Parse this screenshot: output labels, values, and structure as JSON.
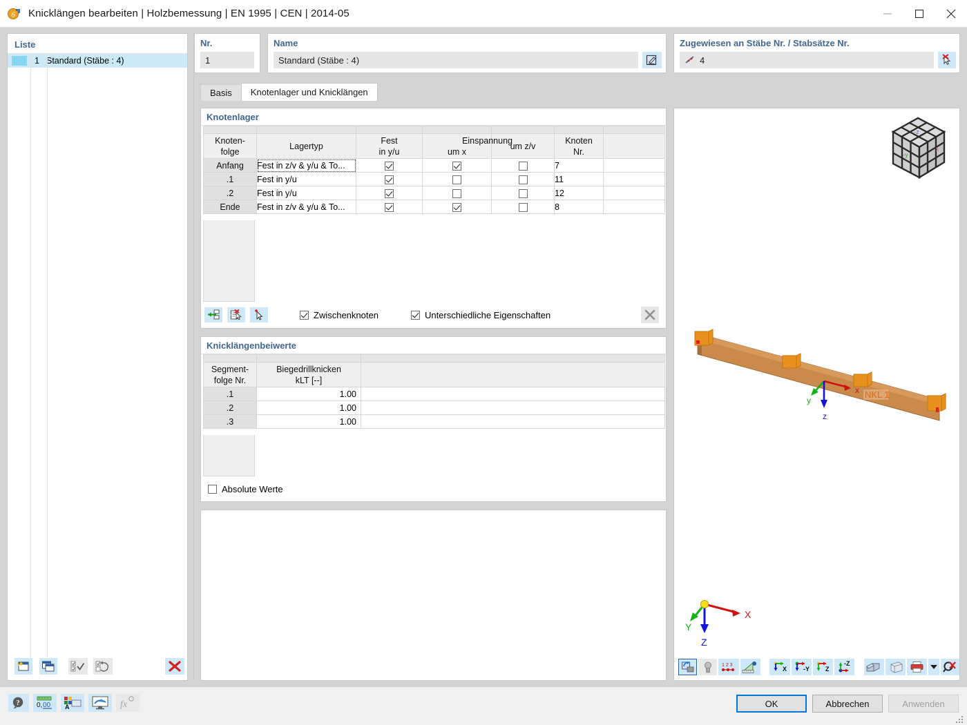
{
  "window": {
    "title": "Knicklängen bearbeiten | Holzbemessung | EN 1995 | CEN | 2014-05",
    "app_icon": "rfem-dimension-icon",
    "minimize_label": "—",
    "maximize_label": "□",
    "close_label": "✕"
  },
  "liste": {
    "title": "Liste",
    "rows": [
      {
        "number": "1",
        "label": "Standard (Stäbe : 4)",
        "color": "#86d6f2"
      }
    ],
    "toolbar": [
      {
        "name": "new-item-button",
        "tip": "Neu"
      },
      {
        "name": "copy-item-button",
        "tip": "Kopieren"
      },
      {
        "name": "select-all-button",
        "tip": "Alle auswählen"
      },
      {
        "name": "invert-selection-button",
        "tip": "Auswahl umkehren"
      },
      {
        "name": "delete-item-button",
        "tip": "Löschen"
      }
    ]
  },
  "nr": {
    "title": "Nr.",
    "value": "1"
  },
  "name": {
    "title": "Name",
    "value": "Standard (Stäbe : 4)",
    "edit_button": "edit-name-button"
  },
  "assigned": {
    "title": "Zugewiesen an Stäbe Nr. / Stabsätze Nr.",
    "value": "4",
    "pick_button": "pick-members-button"
  },
  "tabs": [
    {
      "label": "Basis",
      "active": false
    },
    {
      "label": "Knotenlager und Knicklängen",
      "active": true
    }
  ],
  "knotenlager": {
    "title": "Knotenlager",
    "columns": [
      {
        "l1": "Knoten-",
        "l2": "folge"
      },
      {
        "l1": "",
        "l2": "Lagertyp"
      },
      {
        "l1": "Fest",
        "l2": "in y/u"
      },
      {
        "l1": "Einspannung",
        "l2": "um x"
      },
      {
        "l1": "",
        "l2": "um z/v"
      },
      {
        "l1": "Knoten",
        "l2": "Nr."
      },
      {
        "l1": "",
        "l2": ""
      }
    ],
    "rows": [
      {
        "folge": "Anfang",
        "lagertyp": "Fest in z/v & y/u & To...",
        "fest_yu": true,
        "um_x": true,
        "um_zv": false,
        "knoten": "7",
        "focused": true
      },
      {
        "folge": ".1",
        "lagertyp": "Fest in y/u",
        "fest_yu": true,
        "um_x": false,
        "um_zv": false,
        "knoten": "11",
        "focused": false
      },
      {
        "folge": ".2",
        "lagertyp": "Fest in y/u",
        "fest_yu": true,
        "um_x": false,
        "um_zv": false,
        "knoten": "12",
        "focused": false
      },
      {
        "folge": "Ende",
        "lagertyp": "Fest in z/v & y/u & To...",
        "fest_yu": true,
        "um_x": true,
        "um_zv": false,
        "knoten": "8",
        "focused": false
      }
    ],
    "toolbar": [
      {
        "name": "insert-node-button"
      },
      {
        "name": "edit-support-button"
      },
      {
        "name": "pick-node-button"
      }
    ],
    "checkboxes": [
      {
        "label": "Zwischenknoten",
        "checked": true,
        "name": "zwischenknoten-checkbox"
      },
      {
        "label": "Unterschiedliche Eigenschaften",
        "checked": true,
        "name": "unterschiedliche-eigenschaften-checkbox"
      }
    ],
    "clear_button": "clear-table-button"
  },
  "knicklaengenbeiwerte": {
    "title": "Knicklängenbeiwerte",
    "columns": [
      {
        "l1": "Segment-",
        "l2": "folge Nr."
      },
      {
        "l1": "Biegedrillknicken",
        "l2": "kLT [--]"
      },
      {
        "l1": "",
        "l2": ""
      }
    ],
    "rows": [
      {
        "folge": ".1",
        "klt": "1.00"
      },
      {
        "folge": ".2",
        "klt": "1.00"
      },
      {
        "folge": ".3",
        "klt": "1.00"
      }
    ],
    "absolute_werte": {
      "label": "Absolute Werte",
      "checked": false
    }
  },
  "viewport": {
    "model_label": "NKL 1",
    "axes": {
      "x": "X",
      "y": "Y",
      "z": "Z"
    },
    "local_axes": {
      "x": "x",
      "y": "y",
      "z": "z"
    },
    "cube_faces": {
      "top": "-z",
      "front": "-y",
      "right": "x"
    },
    "toolbar": [
      {
        "name": "render-mode-button",
        "active": true
      },
      {
        "name": "lighting-button",
        "active": false
      },
      {
        "name": "numbering-button",
        "active": true
      },
      {
        "name": "measure-button",
        "active": true
      },
      {
        "name": "view-x-button",
        "active": true
      },
      {
        "name": "view-negy-button",
        "active": true
      },
      {
        "name": "view-z-button",
        "active": true
      },
      {
        "name": "view-negz-button",
        "active": true
      },
      {
        "name": "section-view-button",
        "active": true
      },
      {
        "name": "wireframe-button",
        "active": true
      },
      {
        "name": "print-button",
        "active": true
      },
      {
        "name": "print-dropdown-button",
        "active": true
      },
      {
        "name": "zoom-reset-button",
        "active": true
      }
    ]
  },
  "footer": {
    "tools": [
      {
        "name": "help-button"
      },
      {
        "name": "units-button"
      },
      {
        "name": "display-properties-button"
      },
      {
        "name": "visual-settings-button"
      },
      {
        "name": "formula-button",
        "disabled": true
      }
    ],
    "buttons": [
      {
        "label": "OK",
        "style": "primary",
        "name": "ok-button"
      },
      {
        "label": "Abbrechen",
        "style": "normal",
        "name": "cancel-button"
      },
      {
        "label": "Anwenden",
        "style": "disabled",
        "name": "apply-button"
      }
    ]
  },
  "colors": {
    "accent": "#0078d7",
    "panel_title": "#41678f",
    "selection": "#cce9f8",
    "icon_bg": "#cfe8f7",
    "timber": "#c98a4b",
    "support": "#e8911e"
  }
}
